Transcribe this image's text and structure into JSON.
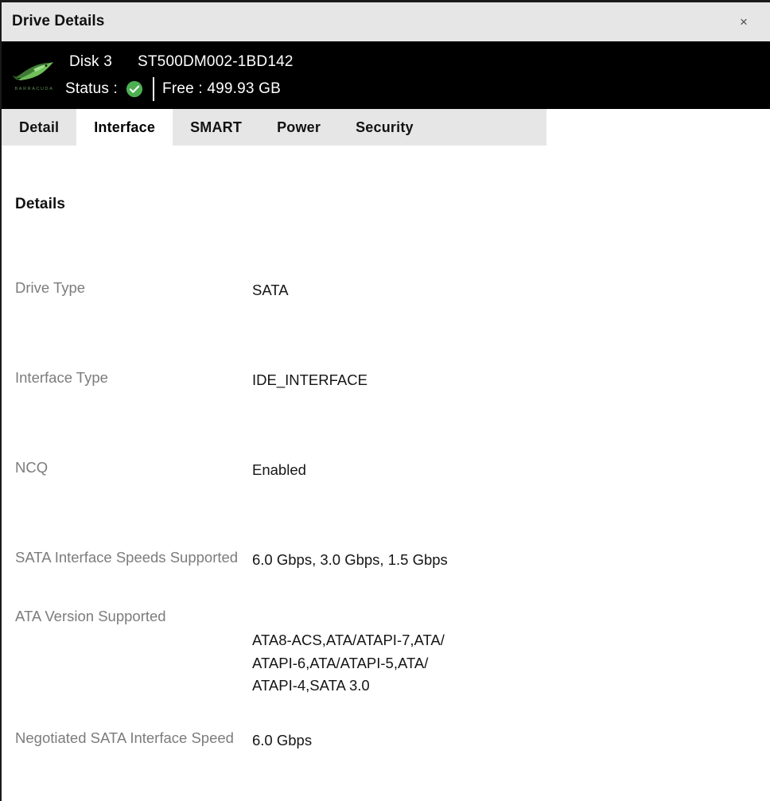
{
  "window": {
    "title": "Drive Details",
    "close_label": "×"
  },
  "drive_header": {
    "brand": "BARRACUDA",
    "disk_label": "Disk 3",
    "model": "ST500DM002-1BD142",
    "status_label": "Status :",
    "status_icon": "check-circle-icon",
    "status_state": "healthy",
    "status_color": "#4caf50",
    "free_label": "Free : 499.93 GB"
  },
  "tabs": [
    {
      "label": "Detail",
      "active": false
    },
    {
      "label": "Interface",
      "active": true
    },
    {
      "label": "SMART",
      "active": false
    },
    {
      "label": "Power",
      "active": false
    },
    {
      "label": "Security",
      "active": false
    }
  ],
  "content": {
    "section_title": "Details",
    "rows": [
      {
        "label": "Drive Type",
        "value": "SATA"
      },
      {
        "label": "Interface Type",
        "value": "IDE_INTERFACE"
      },
      {
        "label": "NCQ",
        "value": "Enabled"
      },
      {
        "label": "SATA Interface Speeds Supported",
        "value": "6.0 Gbps, 3.0 Gbps, 1.5 Gbps"
      },
      {
        "label": "ATA Version Supported",
        "value": "ATA8-ACS,ATA/ATAPI-7,ATA/\nATAPI-6,ATA/ATAPI-5,ATA/\nATAPI-4,SATA 3.0"
      },
      {
        "label": "Negotiated SATA Interface Speed",
        "value": "6.0 Gbps"
      }
    ]
  }
}
